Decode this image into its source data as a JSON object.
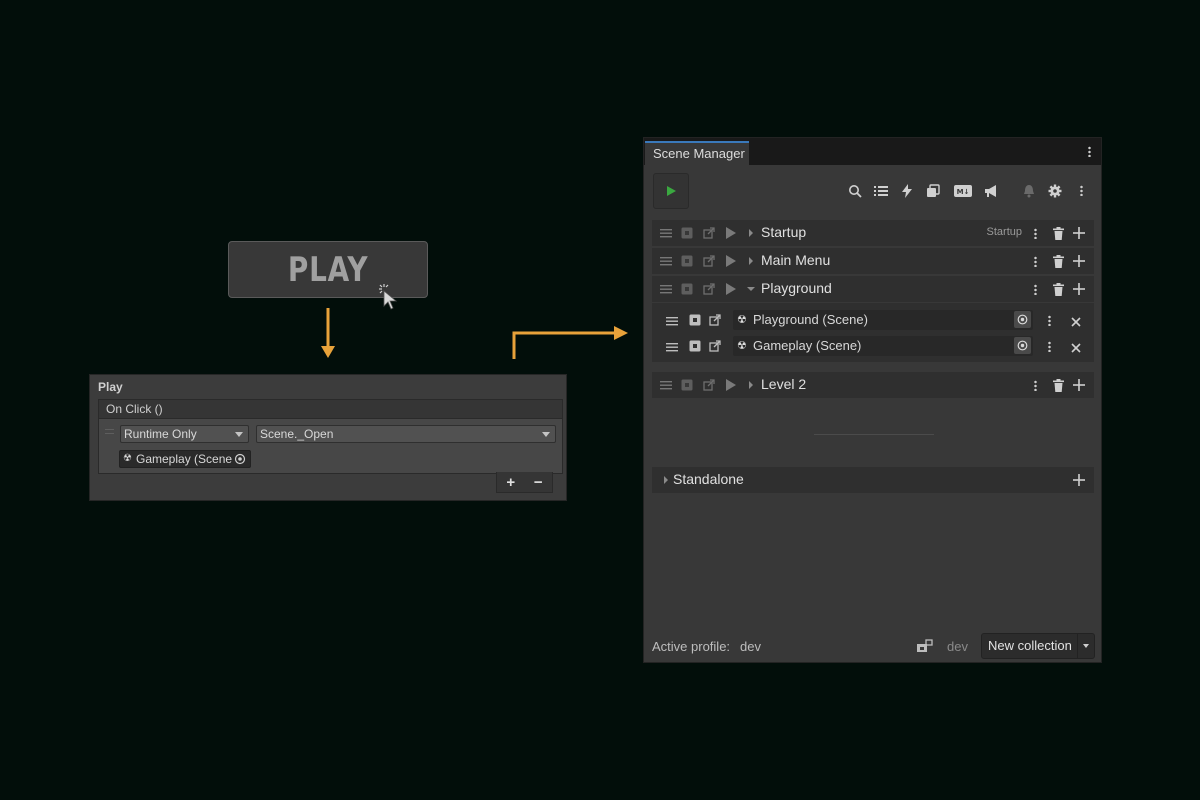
{
  "play_button": {
    "label": "PLAY"
  },
  "inspector": {
    "title": "Play",
    "event_header": "On Click ()",
    "runtime_dropdown": "Runtime Only",
    "function_dropdown": "Scene._Open",
    "object_field": "Gameplay (Scene",
    "add_label": "+",
    "remove_label": "−"
  },
  "scene_manager": {
    "tab_title": "Scene Manager",
    "toolbar_icons": [
      "play-icon",
      "search-icon",
      "list-icon",
      "lightning-icon",
      "collections-icon",
      "markdown-icon",
      "megaphone-icon",
      "bell-icon",
      "gear-icon",
      "menu-icon"
    ],
    "collections": [
      {
        "name": "Startup",
        "tag": "Startup"
      },
      {
        "name": "Main Menu",
        "tag": ""
      },
      {
        "name": "Playground",
        "tag": ""
      },
      {
        "name": "Level 2",
        "tag": ""
      }
    ],
    "playground_scenes": [
      {
        "name": "Playground (Scene)"
      },
      {
        "name": "Gameplay (Scene)"
      }
    ],
    "standalone_label": "Standalone",
    "footer": {
      "active_profile_label": "Active profile:",
      "active_profile_value": "dev",
      "profile_short": "dev",
      "new_collection_label": "New collection"
    }
  },
  "colors": {
    "background": "#020e0a",
    "arrow": "#e8a23a",
    "play_green": "#3aa840",
    "tab_accent": "#3a79bb"
  }
}
